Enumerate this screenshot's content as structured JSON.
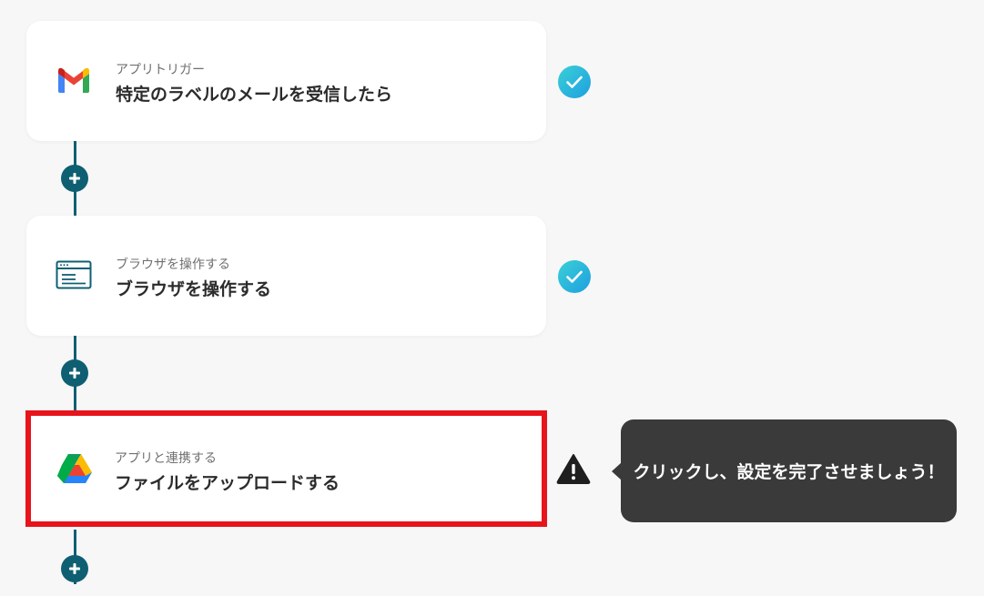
{
  "steps": [
    {
      "subtitle": "アプリトリガー",
      "title": "特定のラベルのメールを受信したら",
      "icon": "gmail-icon",
      "status": "complete"
    },
    {
      "subtitle": "ブラウザを操作する",
      "title": "ブラウザを操作する",
      "icon": "browser-window-icon",
      "status": "complete"
    },
    {
      "subtitle": "アプリと連携する",
      "title": "ファイルをアップロードする",
      "icon": "google-drive-icon",
      "status": "warning"
    }
  ],
  "tooltip": {
    "text": "クリックし、設定を完了させましょう！"
  },
  "colors": {
    "connector": "#0f5f73",
    "check_gradient_start": "#3ad0d7",
    "check_gradient_end": "#1e9fe0",
    "highlight_border": "#e8141b",
    "tooltip_bg": "#3a3a3a",
    "page_bg": "#f7f7f7"
  }
}
